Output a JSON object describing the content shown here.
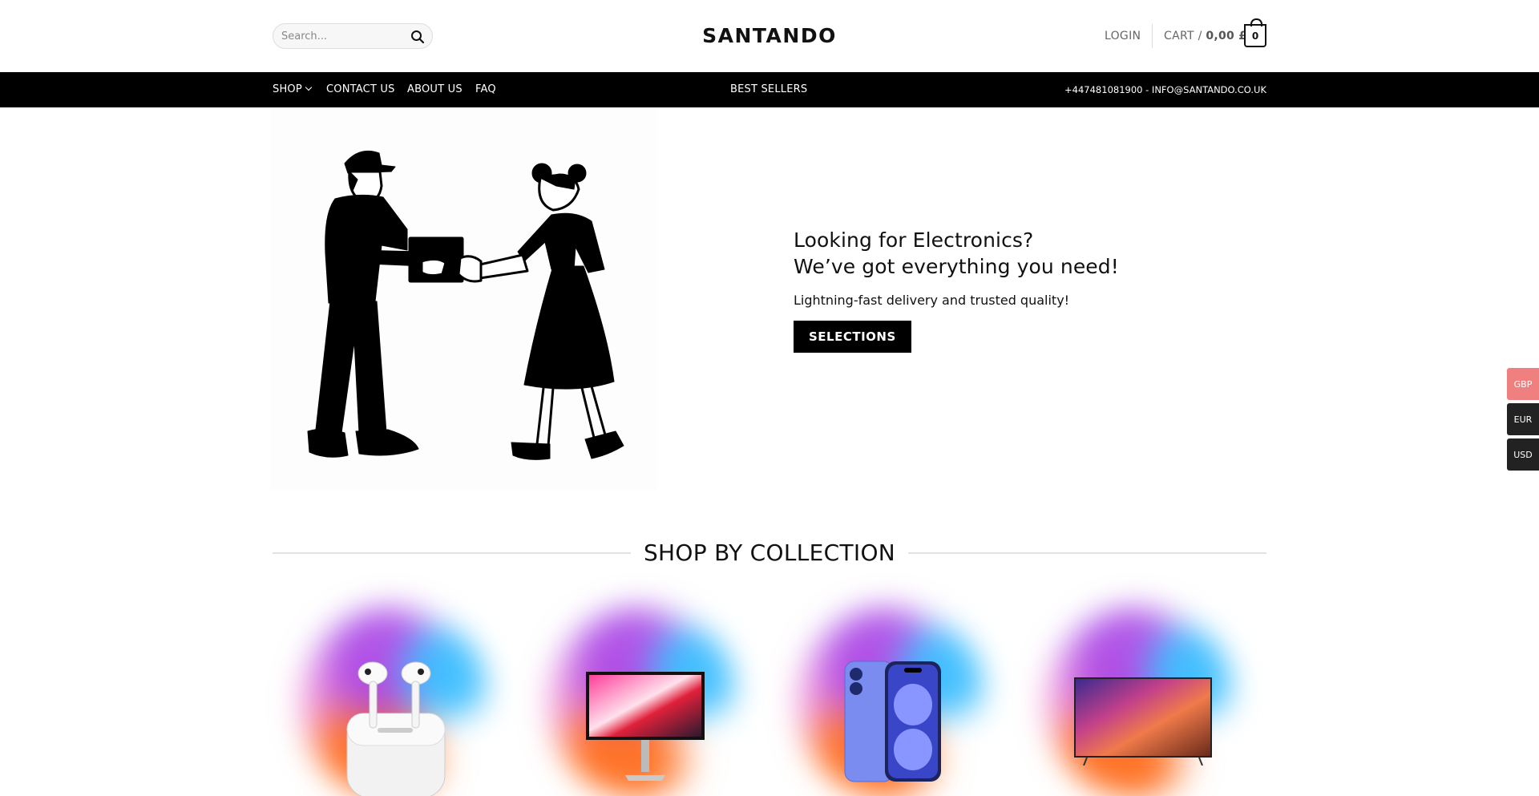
{
  "header": {
    "search_placeholder": "Search...",
    "logo": "SANTANDO",
    "login": "LOGIN",
    "cart_label": "CART /",
    "cart_total": "0,00 £",
    "cart_count": "0"
  },
  "nav": {
    "items": [
      {
        "label": "SHOP"
      },
      {
        "label": "CONTACT US"
      },
      {
        "label": "ABOUT US"
      },
      {
        "label": "FAQ"
      }
    ],
    "center": "BEST SELLERS",
    "contact": "+447481081900 - INFO@SANTANDO.CO.UK"
  },
  "hero": {
    "title_line1": "Looking for Electronics?",
    "title_line2": "We’ve got everything you need!",
    "subtitle": "Lightning-fast delivery and trusted quality!",
    "button": "SELECTIONS"
  },
  "collection": {
    "title": "SHOP BY COLLECTION",
    "products": [
      {
        "icon": "earbuds-icon"
      },
      {
        "icon": "monitor-icon"
      },
      {
        "icon": "smartphone-icon"
      },
      {
        "icon": "tv-icon"
      }
    ]
  },
  "currencies": [
    {
      "code": "GBP",
      "color": "#f08080"
    },
    {
      "code": "EUR",
      "color": "#222222"
    },
    {
      "code": "USD",
      "color": "#222222"
    }
  ]
}
